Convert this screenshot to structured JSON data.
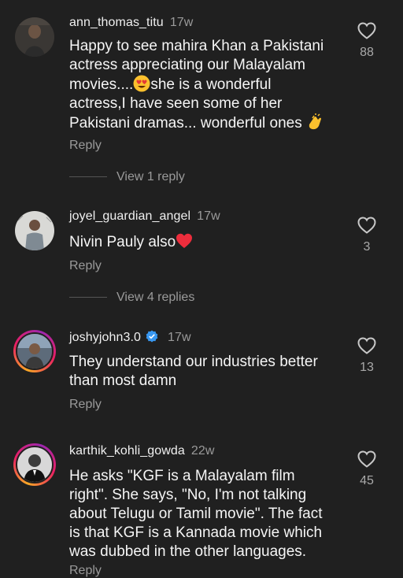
{
  "comments": [
    {
      "username": "ann_thomas_titu",
      "time": "17w",
      "text_parts": [
        "Happy to see mahira Khan a Pakistani",
        "actress appreciating our Malayalam",
        "movies....",
        "she is a wonderful",
        "actress,I have seen some of her",
        "Pakistani dramas... wonderful ones "
      ],
      "reply": "Reply",
      "likes": "88",
      "view_replies": "View 1 reply"
    },
    {
      "username": "joyel_guardian_angel",
      "time": "17w",
      "text": "Nivin Pauly  also",
      "reply": "Reply",
      "likes": "3",
      "view_replies": "View 4 replies"
    },
    {
      "username": "joshyjohn3.0",
      "time": "17w",
      "verified": true,
      "text_lines": [
        "They understand our industries better",
        "than most damn"
      ],
      "reply": "Reply",
      "likes": "13"
    },
    {
      "username": "karthik_kohli_gowda",
      "time": "22w",
      "text_lines": [
        "He asks \"KGF is a Malayalam film",
        "right\". She says, \"No, I'm not talking",
        "about Telugu or Tamil movie\". The fact",
        "is that KGF is a Kannada movie which",
        "was dubbed in the other languages."
      ],
      "reply": "Reply",
      "likes": "45"
    }
  ],
  "icons": {
    "heart": "heart-outline-icon",
    "heart_eyes": "heart-eyes-emoji",
    "red_heart": "red-heart-emoji",
    "clap": "clapping-hands-emoji",
    "verified": "verified-badge-icon"
  },
  "colors": {
    "background": "#202020",
    "text": "#f2f2f2",
    "muted": "#9a9a9a",
    "verified_blue": "#3897f0",
    "heart_red": "#ed2d3c"
  }
}
